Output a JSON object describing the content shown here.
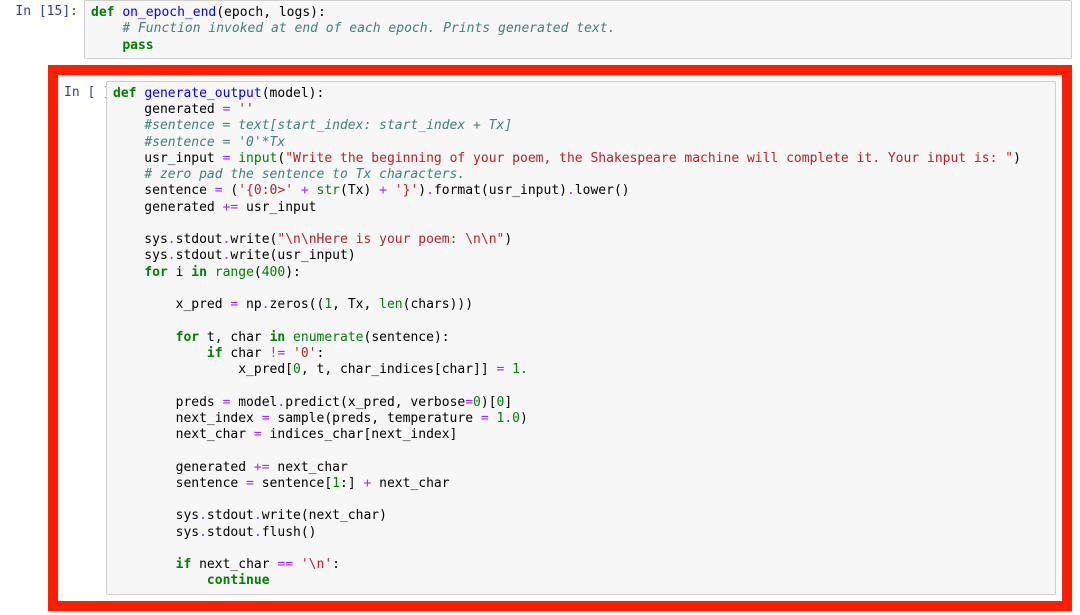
{
  "cells": [
    {
      "prompt": "In [15]:",
      "lines": [
        [
          [
            "kw",
            "def"
          ],
          [
            "",
            " "
          ],
          [
            "def",
            "on_epoch_end"
          ],
          [
            "",
            "(epoch, logs):"
          ]
        ],
        [
          [
            "",
            "    "
          ],
          [
            "cmt",
            "# Function invoked at end of each epoch. Prints generated text."
          ]
        ],
        [
          [
            "",
            "    "
          ],
          [
            "kw",
            "pass"
          ]
        ]
      ]
    },
    {
      "prompt": "In [ ]:",
      "highlighted": true,
      "lines": [
        [
          [
            "kw",
            "def"
          ],
          [
            "",
            " "
          ],
          [
            "def",
            "generate_output"
          ],
          [
            "",
            "(model):"
          ]
        ],
        [
          [
            "",
            "    generated "
          ],
          [
            "op",
            "="
          ],
          [
            "",
            " "
          ],
          [
            "str",
            "''"
          ]
        ],
        [
          [
            "",
            "    "
          ],
          [
            "cmt",
            "#sentence = text[start_index: start_index + Tx]"
          ]
        ],
        [
          [
            "",
            "    "
          ],
          [
            "cmt",
            "#sentence = '0'*Tx"
          ]
        ],
        [
          [
            "",
            "    usr_input "
          ],
          [
            "op",
            "="
          ],
          [
            "",
            " "
          ],
          [
            "bi",
            "input"
          ],
          [
            "",
            "("
          ],
          [
            "str",
            "\"Write the beginning of your poem, the Shakespeare machine will complete it. Your input is: \""
          ],
          [
            "",
            ")"
          ]
        ],
        [
          [
            "",
            "    "
          ],
          [
            "cmt",
            "# zero pad the sentence to Tx characters."
          ]
        ],
        [
          [
            "",
            "    sentence "
          ],
          [
            "op",
            "="
          ],
          [
            "",
            " ("
          ],
          [
            "str",
            "'{0:0>'"
          ],
          [
            "",
            " "
          ],
          [
            "op",
            "+"
          ],
          [
            "",
            " "
          ],
          [
            "bi",
            "str"
          ],
          [
            "",
            "(Tx) "
          ],
          [
            "op",
            "+"
          ],
          [
            "",
            " "
          ],
          [
            "str",
            "'}'"
          ],
          [
            "",
            ")"
          ],
          [
            "op",
            "."
          ],
          [
            "",
            "format(usr_input)"
          ],
          [
            "op",
            "."
          ],
          [
            "",
            "lower()"
          ]
        ],
        [
          [
            "",
            "    generated "
          ],
          [
            "op",
            "+="
          ],
          [
            "",
            " usr_input"
          ]
        ],
        [
          [
            "",
            ""
          ]
        ],
        [
          [
            "",
            "    sys"
          ],
          [
            "op",
            "."
          ],
          [
            "",
            "stdout"
          ],
          [
            "op",
            "."
          ],
          [
            "",
            "write("
          ],
          [
            "str",
            "\"\\n\\nHere is your poem: \\n\\n\""
          ],
          [
            "",
            ")"
          ]
        ],
        [
          [
            "",
            "    sys"
          ],
          [
            "op",
            "."
          ],
          [
            "",
            "stdout"
          ],
          [
            "op",
            "."
          ],
          [
            "",
            "write(usr_input)"
          ]
        ],
        [
          [
            "",
            "    "
          ],
          [
            "kw",
            "for"
          ],
          [
            "",
            " i "
          ],
          [
            "kw",
            "in"
          ],
          [
            "",
            " "
          ],
          [
            "bi",
            "range"
          ],
          [
            "",
            "("
          ],
          [
            "num",
            "400"
          ],
          [
            "",
            "):"
          ]
        ],
        [
          [
            "",
            ""
          ]
        ],
        [
          [
            "",
            "        x_pred "
          ],
          [
            "op",
            "="
          ],
          [
            "",
            " np"
          ],
          [
            "op",
            "."
          ],
          [
            "",
            "zeros(("
          ],
          [
            "num",
            "1"
          ],
          [
            "",
            ", Tx, "
          ],
          [
            "bi",
            "len"
          ],
          [
            "",
            "(chars)))"
          ]
        ],
        [
          [
            "",
            ""
          ]
        ],
        [
          [
            "",
            "        "
          ],
          [
            "kw",
            "for"
          ],
          [
            "",
            " t, char "
          ],
          [
            "kw",
            "in"
          ],
          [
            "",
            " "
          ],
          [
            "bi",
            "enumerate"
          ],
          [
            "",
            "(sentence):"
          ]
        ],
        [
          [
            "",
            "            "
          ],
          [
            "kw",
            "if"
          ],
          [
            "",
            " char "
          ],
          [
            "op",
            "!="
          ],
          [
            "",
            " "
          ],
          [
            "str",
            "'0'"
          ],
          [
            "",
            ":"
          ]
        ],
        [
          [
            "",
            "                x_pred["
          ],
          [
            "num",
            "0"
          ],
          [
            "",
            ", t, char_indices[char]] "
          ],
          [
            "op",
            "="
          ],
          [
            "",
            " "
          ],
          [
            "num",
            "1."
          ]
        ],
        [
          [
            "",
            ""
          ]
        ],
        [
          [
            "",
            "        preds "
          ],
          [
            "op",
            "="
          ],
          [
            "",
            " model"
          ],
          [
            "op",
            "."
          ],
          [
            "",
            "predict(x_pred, verbose"
          ],
          [
            "op",
            "="
          ],
          [
            "num",
            "0"
          ],
          [
            "",
            ")["
          ],
          [
            "num",
            "0"
          ],
          [
            "",
            "]"
          ]
        ],
        [
          [
            "",
            "        next_index "
          ],
          [
            "op",
            "="
          ],
          [
            "",
            " sample(preds, temperature "
          ],
          [
            "op",
            "="
          ],
          [
            "",
            " "
          ],
          [
            "num",
            "1.0"
          ],
          [
            "",
            ")"
          ]
        ],
        [
          [
            "",
            "        next_char "
          ],
          [
            "op",
            "="
          ],
          [
            "",
            " indices_char[next_index]"
          ]
        ],
        [
          [
            "",
            ""
          ]
        ],
        [
          [
            "",
            "        generated "
          ],
          [
            "op",
            "+="
          ],
          [
            "",
            " next_char"
          ]
        ],
        [
          [
            "",
            "        sentence "
          ],
          [
            "op",
            "="
          ],
          [
            "",
            " sentence["
          ],
          [
            "num",
            "1"
          ],
          [
            "",
            ":] "
          ],
          [
            "op",
            "+"
          ],
          [
            "",
            " next_char"
          ]
        ],
        [
          [
            "",
            ""
          ]
        ],
        [
          [
            "",
            "        sys"
          ],
          [
            "op",
            "."
          ],
          [
            "",
            "stdout"
          ],
          [
            "op",
            "."
          ],
          [
            "",
            "write(next_char)"
          ]
        ],
        [
          [
            "",
            "        sys"
          ],
          [
            "op",
            "."
          ],
          [
            "",
            "stdout"
          ],
          [
            "op",
            "."
          ],
          [
            "",
            "flush()"
          ]
        ],
        [
          [
            "",
            ""
          ]
        ],
        [
          [
            "",
            "        "
          ],
          [
            "kw",
            "if"
          ],
          [
            "",
            " next_char "
          ],
          [
            "op",
            "=="
          ],
          [
            "",
            " "
          ],
          [
            "str",
            "'\\n'"
          ],
          [
            "",
            ":"
          ]
        ],
        [
          [
            "",
            "            "
          ],
          [
            "kw",
            "continue"
          ]
        ]
      ]
    }
  ]
}
